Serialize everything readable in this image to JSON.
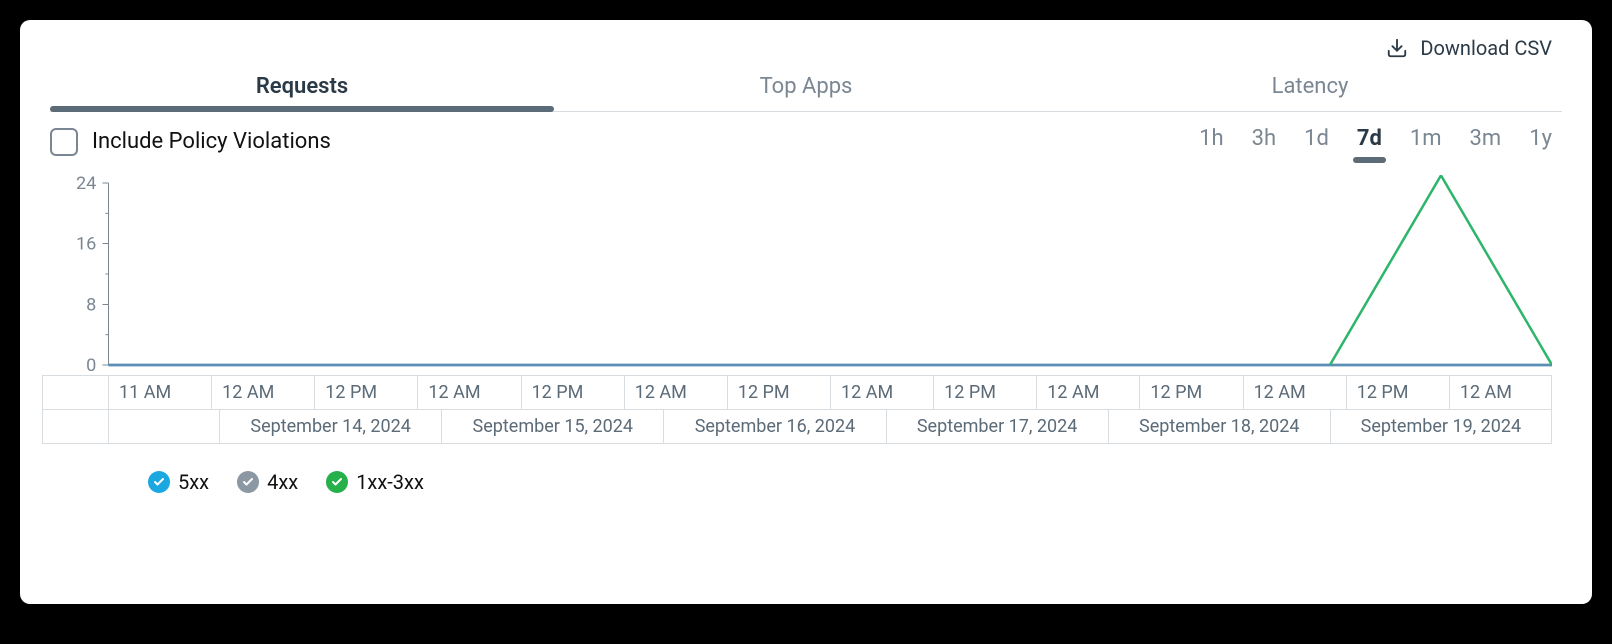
{
  "header": {
    "download_label": "Download CSV"
  },
  "tabs": [
    {
      "label": "Requests",
      "active": true
    },
    {
      "label": "Top Apps",
      "active": false
    },
    {
      "label": "Latency",
      "active": false
    }
  ],
  "options": {
    "include_violations_label": "Include Policy Violations",
    "include_violations_checked": false
  },
  "ranges": [
    {
      "label": "1h",
      "active": false
    },
    {
      "label": "3h",
      "active": false
    },
    {
      "label": "1d",
      "active": false
    },
    {
      "label": "7d",
      "active": true
    },
    {
      "label": "1m",
      "active": false
    },
    {
      "label": "3m",
      "active": false
    },
    {
      "label": "1y",
      "active": false
    }
  ],
  "y_ticks": [
    "24",
    "16",
    "8",
    "0"
  ],
  "x_times": [
    "11 AM",
    "12 AM",
    "12 PM",
    "12 AM",
    "12 PM",
    "12 AM",
    "12 PM",
    "12 AM",
    "12 PM",
    "12 AM",
    "12 PM",
    "12 AM",
    "12 PM",
    "12 AM"
  ],
  "x_days": [
    "September 14, 2024",
    "September 15, 2024",
    "September 16, 2024",
    "September 17, 2024",
    "September 18, 2024",
    "September 19, 2024"
  ],
  "legend": [
    {
      "label": "5xx",
      "color": "blue"
    },
    {
      "label": "4xx",
      "color": "gray"
    },
    {
      "label": "1xx-3xx",
      "color": "green"
    }
  ],
  "chart_data": {
    "type": "line",
    "xlabel": "",
    "ylabel": "",
    "ylim": [
      0,
      24
    ],
    "x": [
      "2024-09-13 11:00",
      "2024-09-14 00:00",
      "2024-09-14 12:00",
      "2024-09-15 00:00",
      "2024-09-15 12:00",
      "2024-09-16 00:00",
      "2024-09-16 12:00",
      "2024-09-17 00:00",
      "2024-09-17 12:00",
      "2024-09-18 00:00",
      "2024-09-18 12:00",
      "2024-09-19 00:00",
      "2024-09-19 12:00",
      "2024-09-20 00:00"
    ],
    "series": [
      {
        "name": "5xx",
        "values": [
          0,
          0,
          0,
          0,
          0,
          0,
          0,
          0,
          0,
          0,
          0,
          0,
          0,
          0
        ]
      },
      {
        "name": "4xx",
        "values": [
          0,
          0,
          0,
          0,
          0,
          0,
          0,
          0,
          0,
          0,
          0,
          0,
          0,
          0
        ]
      },
      {
        "name": "1xx-3xx",
        "values": [
          null,
          null,
          null,
          null,
          null,
          null,
          null,
          null,
          null,
          null,
          null,
          0,
          25,
          0
        ]
      }
    ]
  }
}
